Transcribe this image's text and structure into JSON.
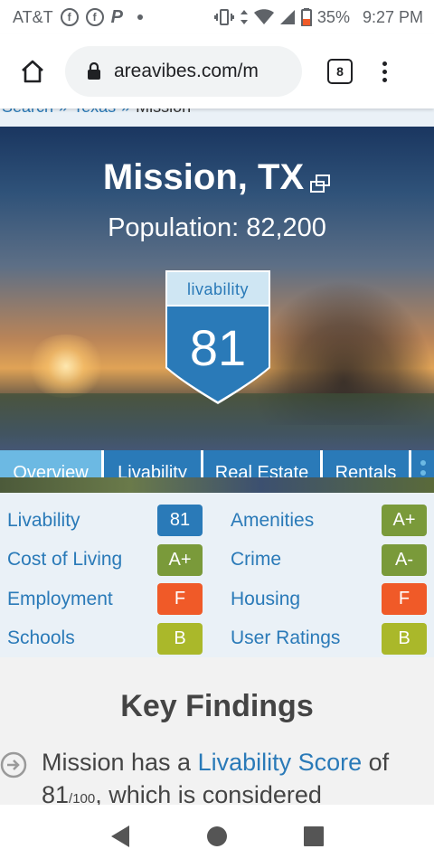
{
  "status_bar": {
    "carrier": "AT&T",
    "battery": "35%",
    "time": "9:27 PM",
    "icons": [
      "facebook-icon",
      "facebook-icon",
      "paypal-icon",
      "dot-icon",
      "vibrate-icon",
      "data-arrows-icon",
      "wifi-icon",
      "signal-icon",
      "battery-icon"
    ]
  },
  "browser": {
    "url": "areavibes.com/m",
    "tab_count": "8"
  },
  "breadcrumb": {
    "items": [
      "Search",
      "Texas",
      "Mission"
    ],
    "separator": "»"
  },
  "hero": {
    "title": "Mission, TX",
    "population": "Population: 82,200",
    "livability_label": "livability",
    "livability_score": "81"
  },
  "tabs": [
    {
      "label": "Overview",
      "active": true
    },
    {
      "label": "Livability",
      "active": false
    },
    {
      "label": "Real Estate",
      "active": false
    },
    {
      "label": "Rentals",
      "active": false
    }
  ],
  "grades": [
    {
      "label": "Livability",
      "grade": "81",
      "color": "#2a7ab8"
    },
    {
      "label": "Amenities",
      "grade": "A+",
      "color": "#7a9a3a"
    },
    {
      "label": "Cost of Living",
      "grade": "A+",
      "color": "#7a9a3a"
    },
    {
      "label": "Crime",
      "grade": "A-",
      "color": "#7a9a3a"
    },
    {
      "label": "Employment",
      "grade": "F",
      "color": "#f05a28"
    },
    {
      "label": "Housing",
      "grade": "F",
      "color": "#f05a28"
    },
    {
      "label": "Schools",
      "grade": "B",
      "color": "#aab82a"
    },
    {
      "label": "User Ratings",
      "grade": "B",
      "color": "#aab82a"
    }
  ],
  "key_findings": {
    "title": "Key Findings",
    "text_1": "Mission has a ",
    "link": "Livability Score",
    "text_2": " of",
    "score": "81",
    "score_suffix": "/100",
    "text_3": ", which is considered"
  },
  "colors": {
    "brand_blue": "#2a7ab8",
    "tab_active": "#6cb9e3"
  }
}
